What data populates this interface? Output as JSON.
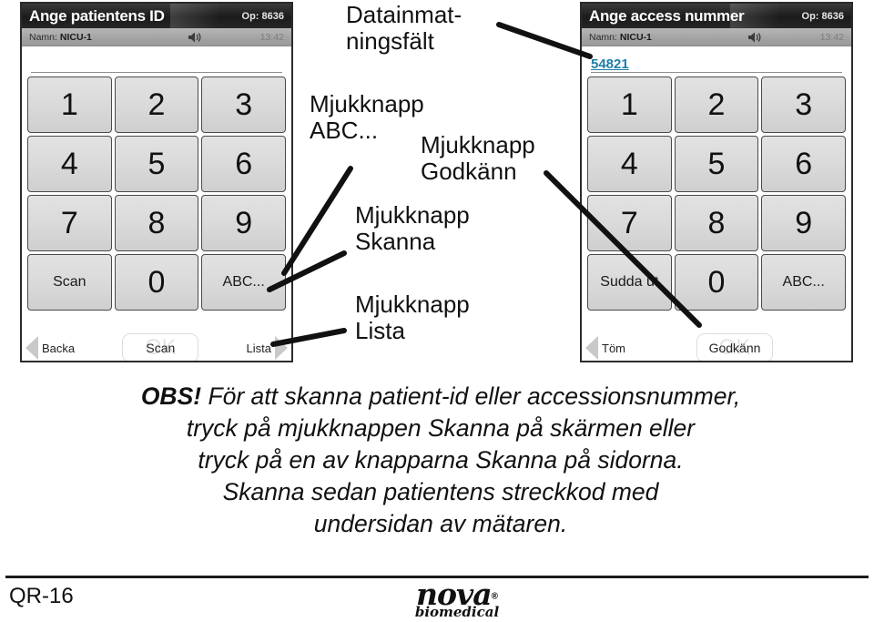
{
  "devices": [
    {
      "id": "left",
      "title": "Ange patientens ID",
      "operator": "Op: 8636",
      "name_label": "Namn:",
      "name_value": "NICU-1",
      "speaker_icon": "speaker-icon",
      "clock": "13:42",
      "entry_value": "",
      "keys": [
        "1",
        "2",
        "3",
        "4",
        "5",
        "6",
        "7",
        "8",
        "9",
        "Scan",
        "0",
        "ABC..."
      ],
      "soft_left": "Backa",
      "soft_center": "Scan",
      "soft_center_ghost": "OK",
      "soft_right": "Lista",
      "left_arrow_icon": "arrow-left-icon",
      "right_arrow_icon": "arrow-right-icon"
    },
    {
      "id": "right",
      "title": "Ange access nummer",
      "operator": "Op: 8636",
      "name_label": "Namn:",
      "name_value": "NICU-1",
      "speaker_icon": "speaker-icon",
      "clock": "13:42",
      "entry_value": "54821",
      "keys": [
        "1",
        "2",
        "3",
        "4",
        "5",
        "6",
        "7",
        "8",
        "9",
        "Sudda ut",
        "0",
        "ABC..."
      ],
      "soft_left": "Töm",
      "soft_center": "Godkänn",
      "soft_center_ghost": "OK",
      "soft_right": "",
      "left_arrow_icon": "arrow-left-icon",
      "right_arrow_icon": "arrow-right-icon"
    }
  ],
  "callouts": {
    "entry_field": "Datainmat-\nningsfält",
    "soft_abc": "Mjukknapp\nABC...",
    "soft_godkann": "Mjukknapp\nGodkänn",
    "soft_skanna": "Mjukknapp\nSkanna",
    "soft_lista": "Mjukknapp\nLista"
  },
  "note": {
    "emphasis": "OBS!",
    "line1": "För att skanna patient-id eller accessionsnummer,",
    "line2": "tryck på mjukknappen Skanna på skärmen eller",
    "line3": "tryck på en av knapparna Skanna på sidorna.",
    "line4": "Skanna sedan patientens streckkod med",
    "line5": "undersidan av mätaren."
  },
  "footer": {
    "doc_code": "QR-16",
    "logo_word": "nova",
    "logo_reg": "®",
    "logo_sub": "biomedical"
  },
  "colors": {
    "accent_entry": "#1f7fa8",
    "title_bar": "#1b1b1b",
    "sub_bar": "#a2a2a2",
    "key_face": "#dadada"
  }
}
